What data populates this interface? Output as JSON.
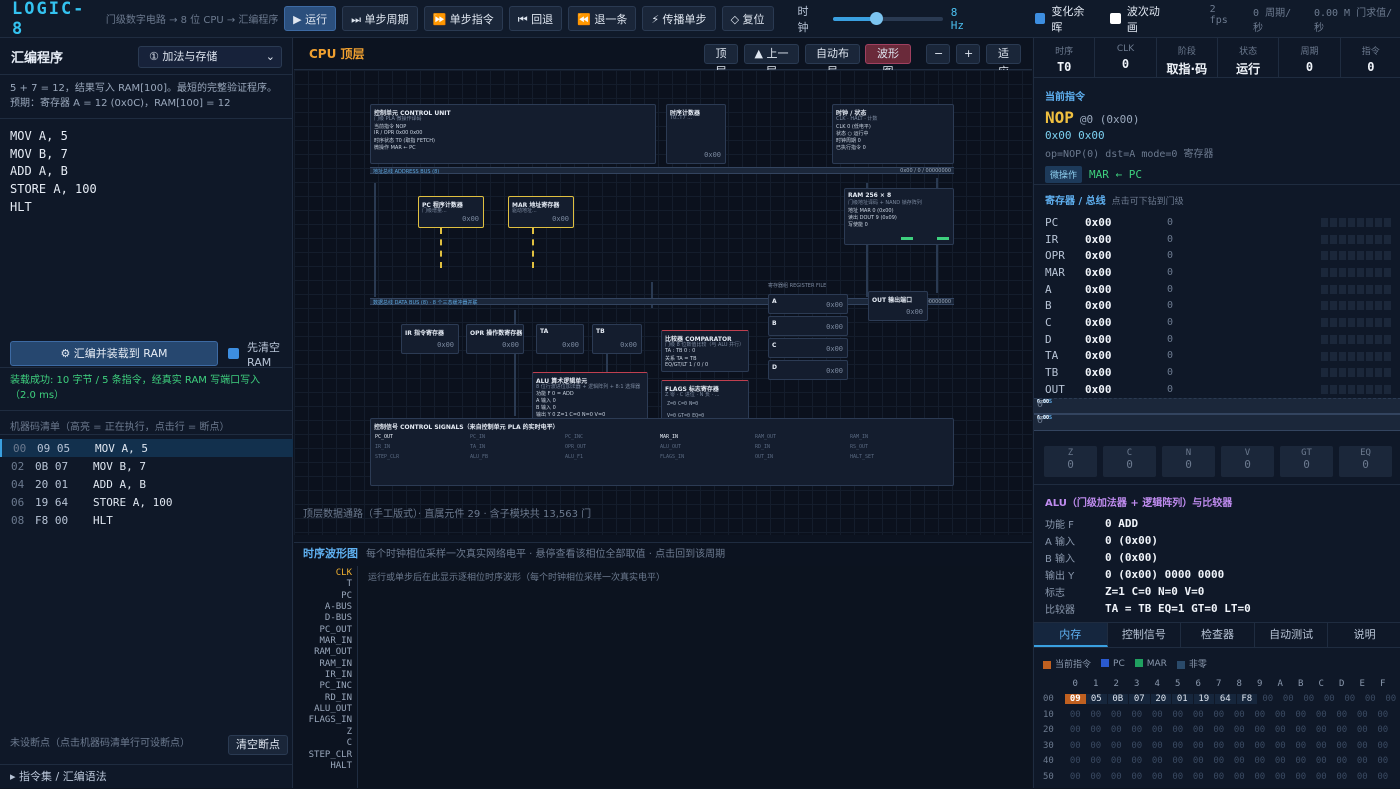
{
  "topbar": {
    "logo": "LOGIC-8",
    "subtitle": "门级数字电路 → 8 位 CPU → 汇编程序",
    "buttons": [
      "▶ 运行",
      "⏭ 单步周期",
      "⏩ 单步指令",
      "⏮ 回退",
      "⏪ 退一条",
      "⚡ 传播单步",
      "◇ 复位"
    ],
    "clock_label": "时钟",
    "clock_value": "8 Hz",
    "clock_fraction": 0.33,
    "toggle_glow": "变化余晖",
    "toggle_wave": "波次动画",
    "fps": "2 fps",
    "cycles": "0 周期/秒",
    "gates": "0.00 M 门求值/秒"
  },
  "left": {
    "title": "汇编程序",
    "program_select": "① 加法与存储",
    "desc_line1": "5 + 7 = 12，结果写入 RAM[100]。最短的完整验证程序。",
    "desc_line2": "预期：寄存器 A = 12 (0x0C)，RAM[100] = 12",
    "source": [
      "MOV A, 5",
      "MOV B, 7",
      "ADD A, B",
      "STORE A, 100",
      "HLT"
    ],
    "assemble_button": "⚙ 汇编并装载到 RAM",
    "clear_ram_label_1": "先清空",
    "clear_ram_label_2": "RAM",
    "assemble_msg": "装载成功: 10 字节 / 5 条指令，经真实 RAM 写端口写入（2.0 ms）",
    "mc_label": "机器码清单（高亮 = 正在执行，点击行 = 断点）",
    "machine_code": [
      {
        "addr": "00",
        "hex": "09 05",
        "src": "MOV A, 5"
      },
      {
        "addr": "02",
        "hex": "0B 07",
        "src": "MOV B, 7"
      },
      {
        "addr": "04",
        "hex": "20 01",
        "src": "ADD A, B"
      },
      {
        "addr": "06",
        "hex": "19 64",
        "src": "STORE A, 100"
      },
      {
        "addr": "08",
        "hex": "F8 00",
        "src": "HLT"
      }
    ],
    "bp_hint": "未设断点（点击机器码清单行可设断点）",
    "bp_clear": "清空断点",
    "isa_label": "▸ 指令集 / 汇编语法"
  },
  "center": {
    "title": "CPU 顶层",
    "nav_top": "顶层",
    "nav_up": "▲ 上一层",
    "nav_auto": "自动布局",
    "nav_wave": "波形图",
    "zoom_out": "−",
    "zoom_in": "+",
    "fit": "适应",
    "canvas_footer": "顶层数据通路（手工版式）· 直属元件 29 · 含子模块共 13,563 门",
    "wave_title": "时序波形图",
    "wave_sub": "每个时钟相位采样一次真实网络电平 · 悬停查看该相位全部取值 · 点击回到该周期",
    "wave_hint": "运行或单步后在此显示逐相位时序波形（每个时钟相位采样一次真实电平）",
    "wave_signals": [
      "CLK",
      "T",
      "PC",
      "A-BUS",
      "D-BUS",
      "PC_OUT",
      "MAR_IN",
      "RAM_OUT",
      "RAM_IN",
      "IR_IN",
      "PC_INC",
      "RD_IN",
      "ALU_OUT",
      "FLAGS_IN",
      "Z",
      "C",
      "STEP_CLR",
      "HALT"
    ],
    "blocks": {
      "cu": "控制单元 CONTROL UNIT",
      "cu_sub": "门级 PLA 微操作译码",
      "cu_rows": [
        "当前指令 NOP",
        "IR / OPR 0x00 0x00",
        "时序状态 T0 (取指 FETCH)",
        "微操作 MAR ← PC"
      ],
      "timing": "时序计数器",
      "timing_sub": "T0..T7 ...",
      "timing_val": "0x00",
      "clk": "时钟 / 状态",
      "clk_sub": "CLK · HALT · 计数",
      "clk_rows": [
        "CLK 0 (低电平)",
        "状态 ○ 运行中",
        "时钟周期 0",
        "已执行指令 0"
      ],
      "abus": "地址总线 ADDRESS BUS (8)",
      "abus_val": "0x00 / 0 / 00000000",
      "pc": "PC 程序计数器",
      "pc_sub": "门级增量...",
      "pc_val": "0x00",
      "mar": "MAR 地址寄存器",
      "mar_sub": "驱动地址...",
      "mar_val": "0x00",
      "ram": "RAM 256 × 8",
      "ram_sub": "门级地址译码 + NAND 锁存阵列",
      "ram_rows": [
        "地址 MAR 0 (0x00)",
        "读出 DOUT 9 (0x09)",
        "写使能 0"
      ],
      "dbus": "数据总线 DATA BUS (8) · 8 个三态缓冲器并联",
      "dbus_val": "0x00 / 0 / 00000000",
      "ir": "IR 指令寄存器",
      "opr": "OPR 操作数寄存器",
      "ta": "TA",
      "tb": "TB",
      "cmp": "比较器 COMPARATOR",
      "cmp_sub": "门级 8 位数值比较（与 ALU 并行）",
      "cmp_rows": [
        "TA : TB 0 : 0",
        "关系 TA = TB",
        "EQ/GT/LT 1 / 0 / 0"
      ],
      "alu": "ALU 算术逻辑单元",
      "alu_sub": "8 位行波进位加法器 + 逻辑阵列 + 8:1 选择器",
      "alu_rows": [
        "功能 F 0 = ADD",
        "A 输入 0",
        "B 输入 0",
        "输出 Y 0 Z=1 C=0 N=0 V=0"
      ],
      "flags": "FLAGS 标志寄存器",
      "flags_sub": "Z 零 · C 进位 · N 负 · ...",
      "flag_chips": [
        "Z=0",
        "C=0",
        "N=0",
        "V=0",
        "GT=0",
        "EQ=0"
      ],
      "rf": "寄存器组 REGISTER FILE",
      "rf_regs": [
        "A",
        "B",
        "C",
        "D"
      ],
      "out": "OUT 输出端口",
      "zero": "0x00",
      "sig": "控制信号 CONTROL SIGNALS（来自控制单元 PLA 的实时电平）",
      "signals": [
        "PC_OUT",
        "PC_IN",
        "PC_INC",
        "MAR_IN",
        "RAM_OUT",
        "RAM_IN",
        "IR_IN",
        "TA_IN",
        "OPR_OUT",
        "ALU_OUT",
        "RD_IN",
        "RS_OUT",
        "STEP_CLR",
        "ALU_FB",
        "ALU_F1",
        "FLAGS_IN",
        "OUT_IN",
        "HALT_SET"
      ]
    }
  },
  "right": {
    "stats": [
      {
        "label": "时序",
        "value": "T0"
      },
      {
        "label": "CLK",
        "value": "0"
      },
      {
        "label": "阶段",
        "value": "取指·码"
      },
      {
        "label": "状态",
        "value": "运行"
      },
      {
        "label": "周期",
        "value": "0"
      },
      {
        "label": "指令",
        "value": "0"
      }
    ],
    "cur_title": "当前指令",
    "cur_op": "NOP",
    "cur_at": "@0 (0x00)",
    "cur_hex": "0x00 0x00",
    "cur_decode": "op=NOP(0) dst=A mode=0 寄存器",
    "uop_tag": "微操作",
    "uop": "MAR ← PC",
    "reg_title": "寄存器 / 总线",
    "reg_hint": "点击可下钻到门级",
    "registers": [
      {
        "name": "PC",
        "hex": "0x00",
        "dec": "0"
      },
      {
        "name": "IR",
        "hex": "0x00",
        "dec": "0"
      },
      {
        "name": "OPR",
        "hex": "0x00",
        "dec": "0"
      },
      {
        "name": "MAR",
        "hex": "0x00",
        "dec": "0"
      },
      {
        "name": "A",
        "hex": "0x00",
        "dec": "0"
      },
      {
        "name": "B",
        "hex": "0x00",
        "dec": "0"
      },
      {
        "name": "C",
        "hex": "0x00",
        "dec": "0"
      },
      {
        "name": "D",
        "hex": "0x00",
        "dec": "0"
      },
      {
        "name": "TA",
        "hex": "0x00",
        "dec": "0"
      },
      {
        "name": "TB",
        "hex": "0x00",
        "dec": "0"
      },
      {
        "name": "OUT",
        "hex": "0x00",
        "dec": "0"
      }
    ],
    "buses": [
      {
        "name": "D-BUS",
        "hex": "0x00",
        "dec": "0"
      },
      {
        "name": "A-BUS",
        "hex": "0x00",
        "dec": "0"
      }
    ],
    "flags": [
      {
        "name": "Z",
        "value": "0"
      },
      {
        "name": "C",
        "value": "0"
      },
      {
        "name": "N",
        "value": "0"
      },
      {
        "name": "V",
        "value": "0"
      },
      {
        "name": "GT",
        "value": "0"
      },
      {
        "name": "EQ",
        "value": "0"
      }
    ],
    "alu_title": "ALU（门级加法器 + 逻辑阵列）与比较器",
    "alu_rows": [
      {
        "k": "功能 F",
        "v": "0 ADD"
      },
      {
        "k": "A 输入",
        "v": "0 (0x00)"
      },
      {
        "k": "B 输入",
        "v": "0 (0x00)"
      },
      {
        "k": "输出 Y",
        "v": "0 (0x00) 0000 0000"
      },
      {
        "k": "标志",
        "v": "Z=1 C=0 N=0 V=0"
      },
      {
        "k": "比较器",
        "v": "TA = TB EQ=1 GT=0 LT=0"
      }
    ],
    "tabs": [
      "内存",
      "控制信号",
      "检查器",
      "自动测试",
      "说明"
    ],
    "legend": [
      {
        "label": "当前指令",
        "color": "#c06020"
      },
      {
        "label": "PC",
        "color": "#2a5ad0"
      },
      {
        "label": "MAR",
        "color": "#20a060"
      },
      {
        "label": "非零",
        "color": "#2a4a6a"
      }
    ],
    "mem_cols": [
      "0",
      "1",
      "2",
      "3",
      "4",
      "5",
      "6",
      "7",
      "8",
      "9",
      "A",
      "B",
      "C",
      "D",
      "E",
      "F"
    ],
    "mem_rows": [
      {
        "addr": "00",
        "cells": [
          "09",
          "05",
          "0B",
          "07",
          "20",
          "01",
          "19",
          "64",
          "F8",
          "00",
          "00",
          "00",
          "00",
          "00",
          "00",
          "00"
        ]
      },
      {
        "addr": "10",
        "cells": [
          "00",
          "00",
          "00",
          "00",
          "00",
          "00",
          "00",
          "00",
          "00",
          "00",
          "00",
          "00",
          "00",
          "00",
          "00",
          "00"
        ]
      },
      {
        "addr": "20",
        "cells": [
          "00",
          "00",
          "00",
          "00",
          "00",
          "00",
          "00",
          "00",
          "00",
          "00",
          "00",
          "00",
          "00",
          "00",
          "00",
          "00"
        ]
      },
      {
        "addr": "30",
        "cells": [
          "00",
          "00",
          "00",
          "00",
          "00",
          "00",
          "00",
          "00",
          "00",
          "00",
          "00",
          "00",
          "00",
          "00",
          "00",
          "00"
        ]
      },
      {
        "addr": "40",
        "cells": [
          "00",
          "00",
          "00",
          "00",
          "00",
          "00",
          "00",
          "00",
          "00",
          "00",
          "00",
          "00",
          "00",
          "00",
          "00",
          "00"
        ]
      },
      {
        "addr": "50",
        "cells": [
          "00",
          "00",
          "00",
          "00",
          "00",
          "00",
          "00",
          "00",
          "00",
          "00",
          "00",
          "00",
          "00",
          "00",
          "00",
          "00"
        ]
      }
    ]
  }
}
